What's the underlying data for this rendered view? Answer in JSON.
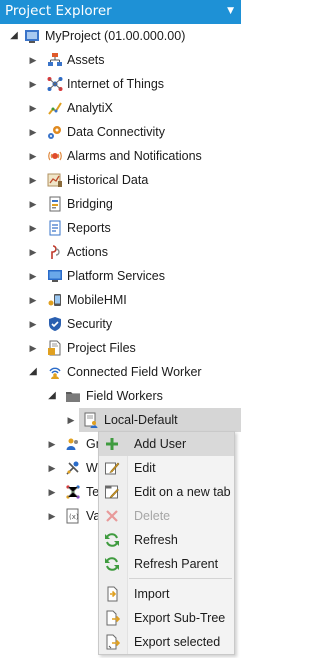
{
  "panel": {
    "title": "Project Explorer",
    "menu_glyph": "▼"
  },
  "tree": {
    "root": {
      "label": "MyProject (01.00.000.00)",
      "icon": "project-icon"
    },
    "items": [
      {
        "label": "Assets",
        "icon": "assets-icon"
      },
      {
        "label": "Internet of Things",
        "icon": "iot-icon"
      },
      {
        "label": "AnalytiX",
        "icon": "analytix-icon"
      },
      {
        "label": "Data Connectivity",
        "icon": "data-connectivity-icon"
      },
      {
        "label": "Alarms and Notifications",
        "icon": "alarms-icon"
      },
      {
        "label": "Historical Data",
        "icon": "historical-data-icon"
      },
      {
        "label": "Bridging",
        "icon": "bridging-icon"
      },
      {
        "label": "Reports",
        "icon": "reports-icon"
      },
      {
        "label": "Actions",
        "icon": "actions-icon"
      },
      {
        "label": "Platform Services",
        "icon": "platform-services-icon"
      },
      {
        "label": "MobileHMI",
        "icon": "mobilehmi-icon"
      },
      {
        "label": "Security",
        "icon": "security-icon"
      },
      {
        "label": "Project Files",
        "icon": "project-files-icon"
      },
      {
        "label": "Connected Field Worker",
        "icon": "connected-field-worker-icon"
      }
    ],
    "field_workers": {
      "label": "Field Workers",
      "icon": "folder-icon"
    },
    "local_default": {
      "label": "Local-Default",
      "icon": "local-default-icon"
    },
    "partial_rows": [
      {
        "label": "Gr",
        "icon": "group-icon"
      },
      {
        "label": "W",
        "icon": "workflow-icon"
      },
      {
        "label": "Te",
        "icon": "template-icon"
      },
      {
        "label": "Va",
        "icon": "variable-icon"
      }
    ]
  },
  "context_menu": {
    "items": [
      {
        "label": "Add User",
        "icon": "plus-icon",
        "enabled": true,
        "hover": true
      },
      {
        "label": "Edit",
        "icon": "edit-icon",
        "enabled": true
      },
      {
        "label": "Edit on a new tab",
        "icon": "edit-new-tab-icon",
        "enabled": true
      },
      {
        "label": "Delete",
        "icon": "delete-icon",
        "enabled": false
      },
      {
        "label": "Refresh",
        "icon": "refresh-icon",
        "enabled": true
      },
      {
        "label": "Refresh Parent",
        "icon": "refresh-parent-icon",
        "enabled": true
      },
      {
        "label": "Import",
        "icon": "import-icon",
        "enabled": true
      },
      {
        "label": "Export Sub-Tree",
        "icon": "export-subtree-icon",
        "enabled": true
      },
      {
        "label": "Export selected",
        "icon": "export-selected-icon",
        "enabled": true
      }
    ]
  },
  "colors": {
    "title_bar": "#1e91d6",
    "selected_row": "#d6d6d6",
    "menu_hover": "#d9d9d9",
    "add_green": "#3f9b3f",
    "delete_red": "#e89a9a"
  }
}
